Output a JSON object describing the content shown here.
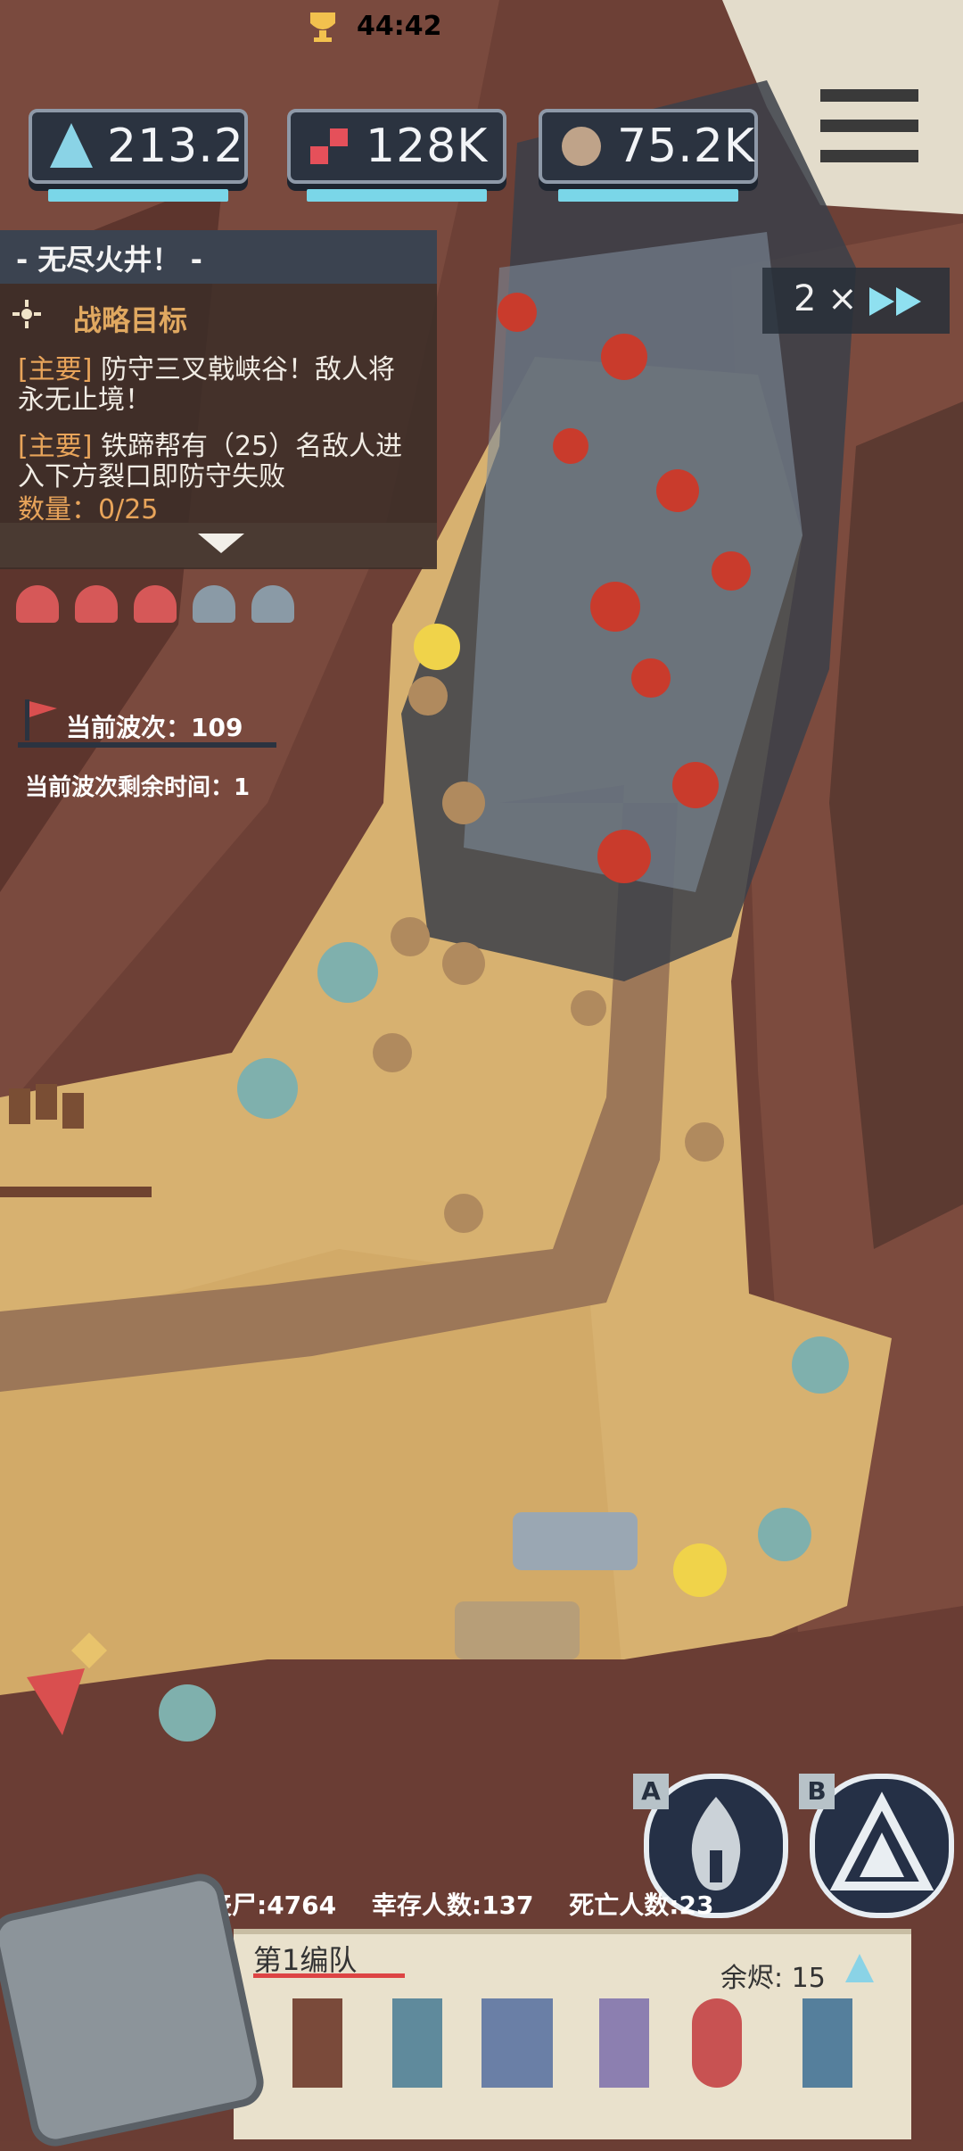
{
  "resources": [
    {
      "value": "213.2",
      "icon": "crystal-icon"
    },
    {
      "value": "128K",
      "icon": "materials-icon"
    },
    {
      "value": "75.2K",
      "icon": "scrap-icon"
    }
  ],
  "mode": {
    "title": "- 无尽火井！ -",
    "timer": "44:42"
  },
  "objectives": {
    "heading": "战略目标",
    "items": [
      {
        "tag": "[主要]",
        "text": "防守三叉戟峡谷！敌人将永无止境！"
      },
      {
        "tag": "[主要]",
        "text": "铁蹄帮有（25）名敌人进入下方裂口即防守失败"
      }
    ],
    "count": "数量：0/25"
  },
  "wave": {
    "label": "当前波次：109",
    "remaining": "当前波次剩余时间：1"
  },
  "speed": {
    "label": "2 ×"
  },
  "bottom": {
    "stats": [
      "丧尸:4764",
      "幸存人数:137",
      "死亡人数:23"
    ],
    "squad_name": "第1编队",
    "ember": "余烬: 15",
    "skill_a": "A",
    "skill_b": "B"
  },
  "colors": {
    "accent": "#7ad6e8",
    "panel": "#2b3340",
    "sand": "#d8b36f",
    "rock": "#6b3e34"
  }
}
